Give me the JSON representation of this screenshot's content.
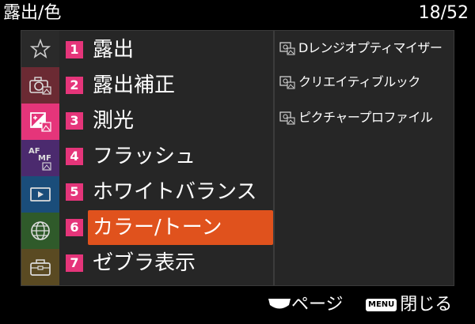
{
  "header": {
    "title": "露出/色",
    "page": "18/52"
  },
  "side_tabs": [
    {
      "name": "star-icon",
      "color": "#2a2a2a"
    },
    {
      "name": "camera-icon",
      "color": "#6b2a33"
    },
    {
      "name": "exposure-icon",
      "color": "#e5357a"
    },
    {
      "name": "af-mf-icon",
      "color": "#4b2a6e"
    },
    {
      "name": "playback-icon",
      "color": "#1a4d7a"
    },
    {
      "name": "network-icon",
      "color": "#2f5a2a"
    },
    {
      "name": "toolbox-icon",
      "color": "#5a4a22"
    }
  ],
  "menu": {
    "items": [
      {
        "num": "1",
        "label": "露出"
      },
      {
        "num": "2",
        "label": "露出補正"
      },
      {
        "num": "3",
        "label": "測光"
      },
      {
        "num": "4",
        "label": "フラッシュ"
      },
      {
        "num": "5",
        "label": "ホワイトバランス"
      },
      {
        "num": "6",
        "label": "カラー/トーン"
      },
      {
        "num": "7",
        "label": "ゼブラ表示"
      }
    ],
    "selected_index": 5,
    "selected_color": "#e0521d",
    "number_color": "#e5357a"
  },
  "submenu": {
    "items": [
      {
        "label": "Dレンジオプティマイザー"
      },
      {
        "label": "クリエイティブルック"
      },
      {
        "label": "ピクチャープロファイル"
      }
    ]
  },
  "footer": {
    "page_label": "ページ",
    "menu_key": "MENU",
    "close_label": "閉じる"
  }
}
